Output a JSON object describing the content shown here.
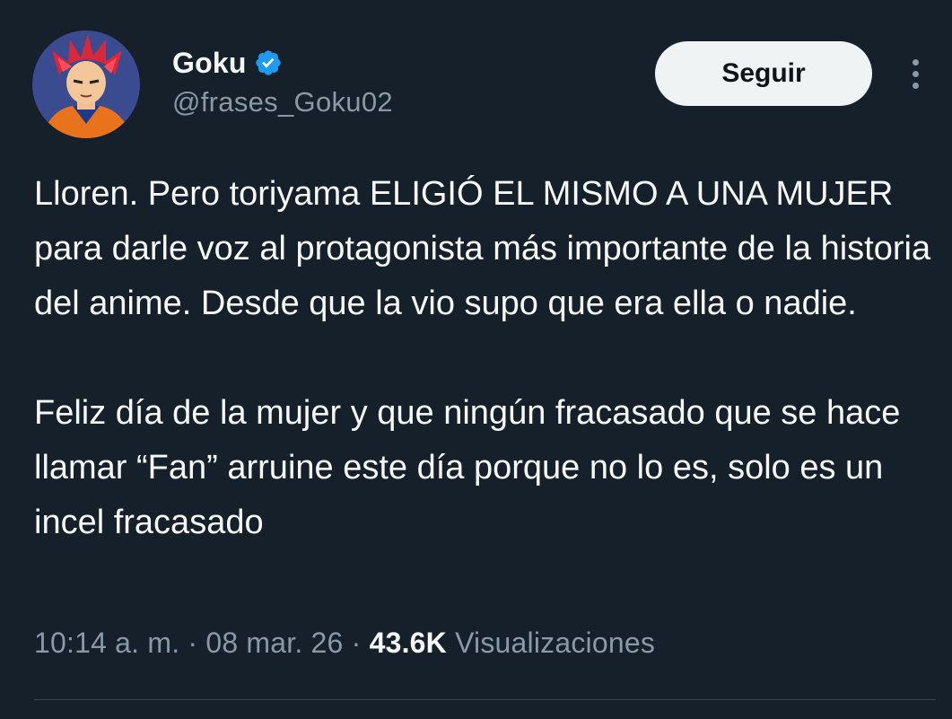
{
  "author": {
    "display_name": "Goku",
    "handle": "@frases_Goku02",
    "verified": true,
    "avatar_icon": "goku-avatar"
  },
  "actions": {
    "follow_label": "Seguir",
    "more_icon": "more-vertical-icon"
  },
  "tweet": {
    "paragraph_1": "Lloren. Pero toriyama ELIGIÓ EL MISMO A UNA MUJER para darle voz al protagonista más importante de la historia del anime. Desde que la vio supo que era ella o nadie.",
    "paragraph_2": "Feliz día de la mujer y que ningún fracasado que se hace llamar “Fan” arruine este día porque no lo es, solo es un incel fracasado"
  },
  "meta": {
    "time": "10:14 a. m.",
    "separator": "·",
    "date": "08 mar. 26",
    "views_count": "43.6K",
    "views_label": "Visualizaciones"
  },
  "colors": {
    "background": "#15202b",
    "text_primary": "#f7f9f9",
    "text_secondary": "#8b98a5",
    "verified_blue": "#1d9bf0",
    "follow_button_bg": "#eff3f4",
    "divider": "#38444d"
  }
}
